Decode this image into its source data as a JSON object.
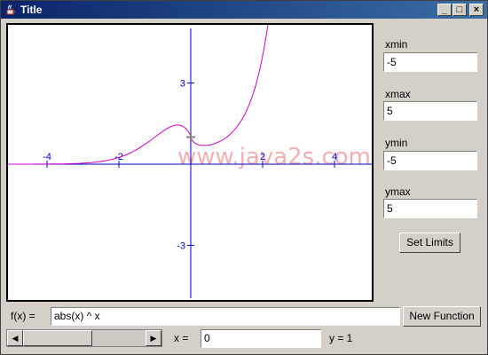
{
  "window": {
    "title": "Title"
  },
  "titlebar_buttons": {
    "minimize": "_",
    "maximize": "□",
    "close": "×"
  },
  "limits": {
    "xmin_label": "xmin",
    "xmin_value": "-5",
    "xmax_label": "xmax",
    "xmax_value": "5",
    "ymin_label": "ymin",
    "ymin_value": "-5",
    "ymax_label": "ymax",
    "ymax_value": "5",
    "set_limits_label": "Set Limits"
  },
  "function": {
    "label": "f(x) =",
    "value": "abs(x) ^ x",
    "new_function_label": "New Function"
  },
  "cursor": {
    "x_label": "x =",
    "x_value": "0",
    "y_readout": "y = 1"
  },
  "watermark": "www.java2s.com",
  "colors": {
    "curve": "#cc00cc",
    "axes": "#0000cc",
    "watermark": "#f2b0b0",
    "cursor": "#808080"
  },
  "chart_data": {
    "type": "line",
    "function": "abs(x) ^ x",
    "xlim": [
      -5,
      5
    ],
    "ylim": [
      -5,
      5
    ],
    "x_ticks": [
      -4,
      -2,
      2,
      4
    ],
    "y_ticks": [
      3,
      -3
    ],
    "cursor_point": {
      "x": 0,
      "y": 1
    }
  }
}
